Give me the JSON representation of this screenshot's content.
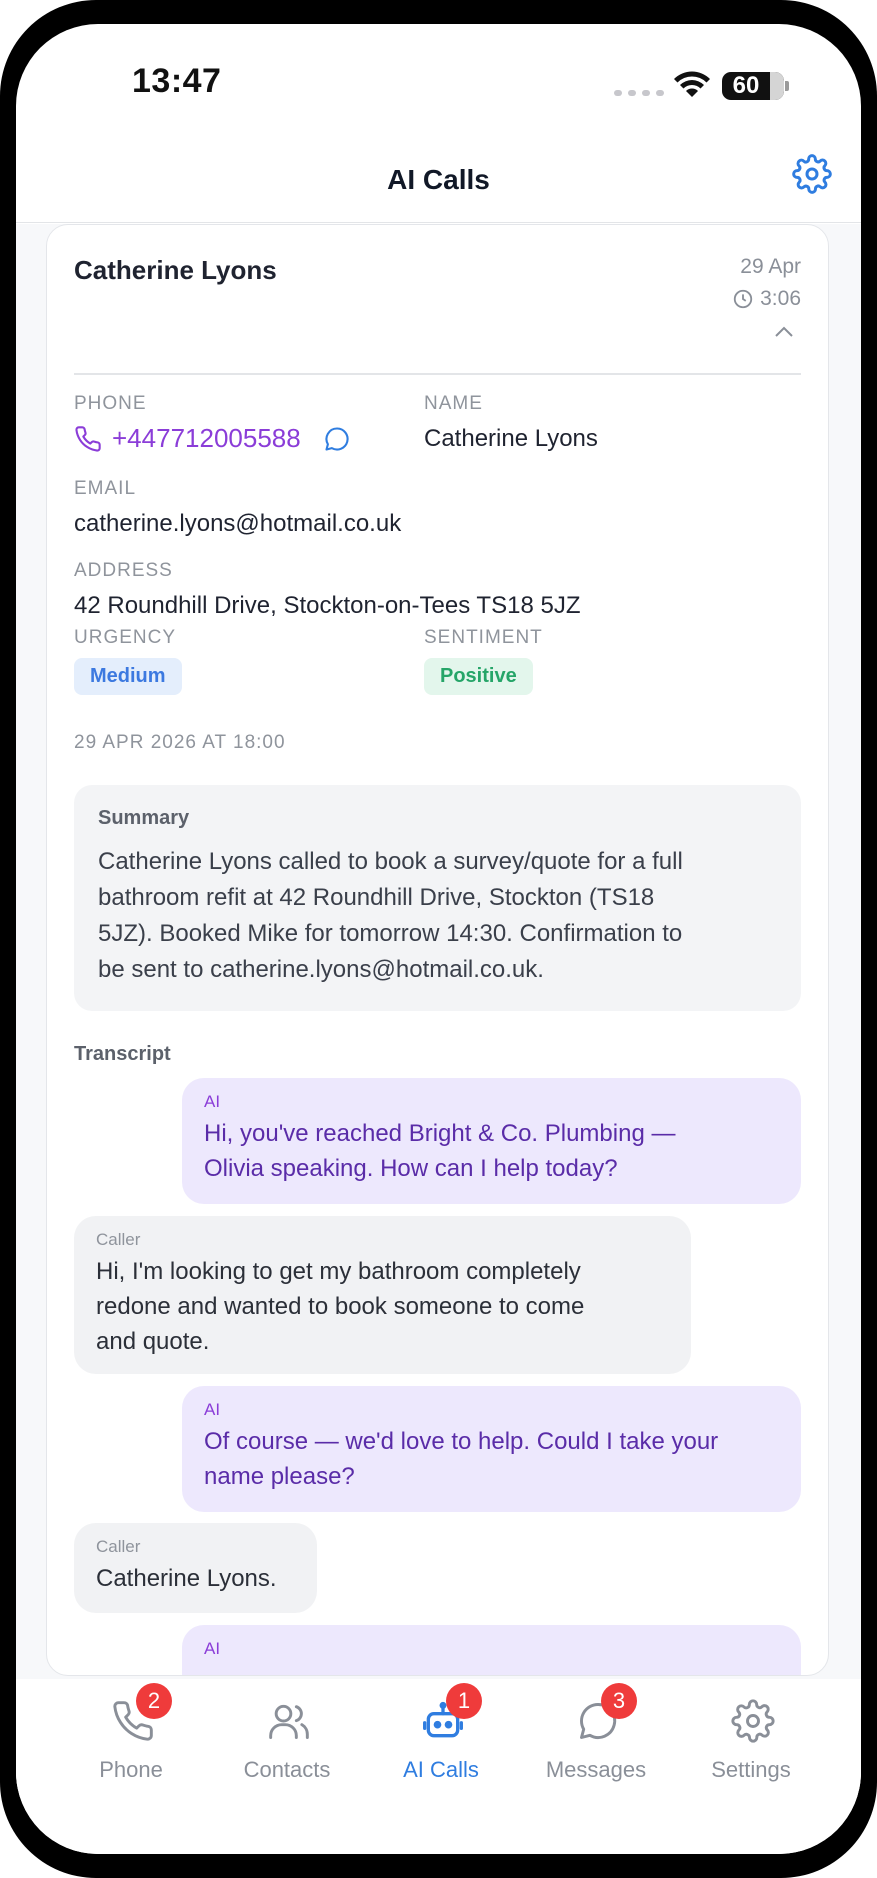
{
  "status_bar": {
    "time": "13:47",
    "battery": "60"
  },
  "header": {
    "title": "AI Calls"
  },
  "call": {
    "caller_name": "Catherine Lyons",
    "date": "29 Apr",
    "duration": "3:06",
    "labels": {
      "phone": "PHONE",
      "name": "NAME",
      "email": "EMAIL",
      "address": "ADDRESS",
      "urgency": "URGENCY",
      "sentiment": "SENTIMENT"
    },
    "phone": "+447712005588",
    "name": "Catherine Lyons",
    "email": "catherine.lyons@hotmail.co.uk",
    "address": "42 Roundhill Drive, Stockton-on-Tees TS18 5JZ",
    "urgency": "Medium",
    "sentiment": "Positive",
    "timestamp": "29 APR 2026 AT 18:00",
    "summary_title": "Summary",
    "summary_lines": [
      "Catherine Lyons called to book a survey/quote for a full",
      "bathroom refit at 42 Roundhill Drive, Stockton (TS18",
      "5JZ). Booked Mike for tomorrow 14:30. Confirmation to",
      "be sent to catherine.lyons@hotmail.co.uk."
    ],
    "transcript_title": "Transcript",
    "transcript": [
      {
        "speaker": "AI",
        "lines": [
          "Hi, you've reached Bright & Co. Plumbing —",
          "Olivia speaking. How can I help today?"
        ]
      },
      {
        "speaker": "Caller",
        "lines": [
          "Hi, I'm looking to get my bathroom completely",
          "redone and wanted to book someone to come",
          "and quote."
        ]
      },
      {
        "speaker": "AI",
        "lines": [
          "Of course — we'd love to help. Could I take your",
          "name please?"
        ]
      },
      {
        "speaker": "Caller",
        "lines": [
          "Catherine Lyons."
        ]
      },
      {
        "speaker": "AI",
        "lines": [
          ""
        ]
      }
    ]
  },
  "tabs": [
    {
      "label": "Phone",
      "icon": "phone-icon",
      "badge": "2"
    },
    {
      "label": "Contacts",
      "icon": "contacts-icon",
      "badge": ""
    },
    {
      "label": "AI Calls",
      "icon": "robot-icon",
      "badge": "1",
      "active": true
    },
    {
      "label": "Messages",
      "icon": "message-icon",
      "badge": "3"
    },
    {
      "label": "Settings",
      "icon": "gear-icon",
      "badge": ""
    }
  ],
  "colors": {
    "accent": "#2f7de0",
    "phone_link": "#8b3dd8",
    "badge_red": "#ef3b3b",
    "ai_bubble": "#ede8fd",
    "caller_bubble": "#f1f2f4"
  }
}
